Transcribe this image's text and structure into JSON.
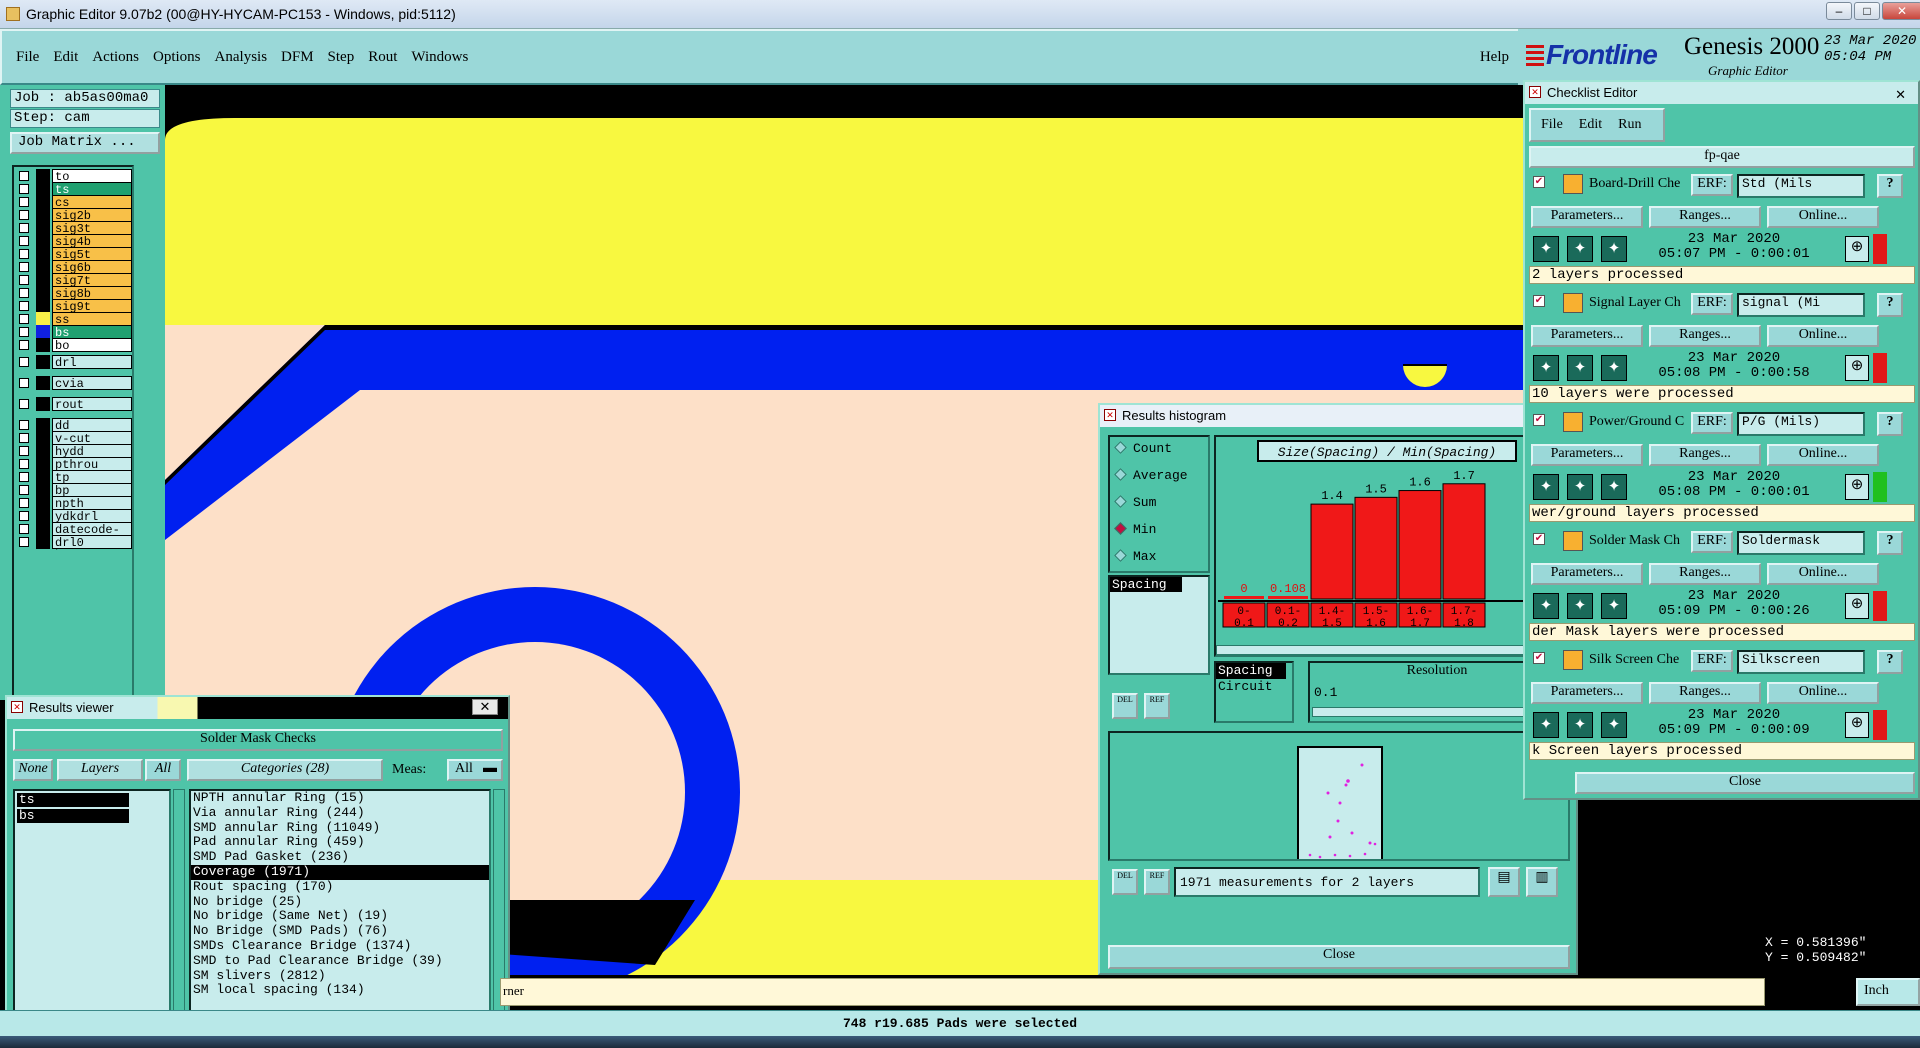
{
  "window": {
    "title": "Graphic Editor 9.07b2 (00@HY-HYCAM-PC153 - Windows, pid:5112)"
  },
  "menu": {
    "items": [
      "File",
      "Edit",
      "Actions",
      "Options",
      "Analysis",
      "DFM",
      "Step",
      "Rout",
      "Windows"
    ],
    "help": "Help"
  },
  "brand": {
    "logo": "Frontline",
    "product": "Genesis 2000",
    "subtitle": "Graphic Editor",
    "date": "23 Mar 2020",
    "time": "05:04 PM"
  },
  "job": {
    "job_label": "Job : ab5as00ma0",
    "step_label": "Step: cam",
    "matrix_button": "Job Matrix ..."
  },
  "layers": [
    {
      "name": "to",
      "kind": "white",
      "swatch": "#000000"
    },
    {
      "name": "ts",
      "kind": "sel",
      "swatch": "#000000"
    },
    {
      "name": "cs",
      "kind": "board",
      "swatch": "#000000"
    },
    {
      "name": "sig2b",
      "kind": "board",
      "swatch": "#000000"
    },
    {
      "name": "sig3t",
      "kind": "board",
      "swatch": "#000000"
    },
    {
      "name": "sig4b",
      "kind": "board",
      "swatch": "#000000"
    },
    {
      "name": "sig5t",
      "kind": "board",
      "swatch": "#000000"
    },
    {
      "name": "sig6b",
      "kind": "board",
      "swatch": "#000000"
    },
    {
      "name": "sig7t",
      "kind": "board",
      "swatch": "#000000"
    },
    {
      "name": "sig8b",
      "kind": "board",
      "swatch": "#000000"
    },
    {
      "name": "sig9t",
      "kind": "board",
      "swatch": "#000000"
    },
    {
      "name": "ss",
      "kind": "board",
      "swatch": "#f8f048"
    },
    {
      "name": "bs",
      "kind": "sel",
      "swatch": "#1020e0"
    },
    {
      "name": "bo",
      "kind": "white",
      "swatch": "#000000"
    },
    {
      "name": "drl",
      "kind": "plain",
      "swatch": "#000000"
    },
    {
      "name": "cvia",
      "kind": "plain",
      "swatch": "#000000"
    },
    {
      "name": "rout",
      "kind": "plain",
      "swatch": "#000000"
    },
    {
      "name": "dd",
      "kind": "plain",
      "swatch": "#000000"
    },
    {
      "name": "v-cut",
      "kind": "plain",
      "swatch": "#000000"
    },
    {
      "name": "hydd",
      "kind": "plain",
      "swatch": "#000000"
    },
    {
      "name": "pthrou",
      "kind": "plain",
      "swatch": "#000000"
    },
    {
      "name": "tp",
      "kind": "plain",
      "swatch": "#000000"
    },
    {
      "name": "bp",
      "kind": "plain",
      "swatch": "#000000"
    },
    {
      "name": "npth",
      "kind": "plain",
      "swatch": "#000000"
    },
    {
      "name": "ydkdrl",
      "kind": "plain",
      "swatch": "#000000"
    },
    {
      "name": "datecode-ptc",
      "kind": "plain",
      "swatch": "#000000"
    },
    {
      "name": "drl0",
      "kind": "plain",
      "swatch": "#000000"
    }
  ],
  "results_viewer": {
    "title": "Results viewer",
    "header": "Solder Mask Checks",
    "none_btn": "None",
    "layers_label": "Layers",
    "all_btn": "All",
    "categories_label": "Categories (28)",
    "meas_label": "Meas:",
    "meas_value": "All",
    "layer_items": [
      "ts",
      "bs"
    ],
    "categories": [
      "NPTH annular Ring (15)",
      "Via annular Ring (244)",
      "SMD annular Ring (11049)",
      "Pad annular Ring (459)",
      "SMD Pad Gasket (236)",
      "Coverage (1971)",
      "Rout spacing (170)",
      "No bridge (25)",
      "No bridge (Same Net) (19)",
      "No Bridge (SMD Pads) (76)",
      "SMDs Clearance Bridge (1374)",
      "SMD to Pad Clearance Bridge (39)",
      "SM slivers (2812)",
      "SM local spacing (134)"
    ],
    "selected_index": 5
  },
  "histogram": {
    "title": "Results histogram",
    "modes": [
      "Count",
      "Average",
      "Sum",
      "Min",
      "Max"
    ],
    "selected_mode": "Min",
    "list_item": "Spacing",
    "chart_title": "Size(Spacing) / Min(Spacing)",
    "chart_data": {
      "type": "bar",
      "categories": [
        "0-0.1",
        "0.1-0.2",
        "1.4-1.5",
        "1.5-1.6",
        "1.6-1.7",
        "1.7-1.8"
      ],
      "values": [
        0,
        0.108,
        1.4,
        1.5,
        1.6,
        1.7
      ],
      "value_labels": [
        "0",
        "0.108",
        "1.4",
        "1.5",
        "1.6",
        "1.7"
      ],
      "ylim": [
        0,
        1.8
      ]
    },
    "sub_list": [
      "Spacing",
      "Circuit"
    ],
    "resolution_label": "Resolution",
    "resolution_value": "0.1",
    "del_label": "DEL",
    "ref_label": "REF",
    "measurements_text": "1971 measurements for 2 layers",
    "close_label": "Close"
  },
  "checklist": {
    "title": "Checklist Editor",
    "menu": [
      "File",
      "Edit",
      "Run"
    ],
    "name": "fp-qae",
    "erf_label": "ERF:",
    "params_label": "Parameters...",
    "ranges_label": "Ranges...",
    "online_label": "Online...",
    "checks": [
      {
        "name": "Board-Drill Che",
        "erf": "Std (Mils",
        "date": "23 Mar 2020",
        "time": "05:07 PM - 0:00:01",
        "status": "2 layers processed",
        "flag": "#e01818"
      },
      {
        "name": "Signal Layer Ch",
        "erf": "signal (Mi",
        "date": "23 Mar 2020",
        "time": "05:08 PM - 0:00:58",
        "status": "10 layers were processed",
        "flag": "#e01818"
      },
      {
        "name": "Power/Ground C",
        "erf": "P/G (Mils)",
        "date": "23 Mar 2020",
        "time": "05:08 PM - 0:00:01",
        "status": "wer/ground layers processed",
        "flag": "#20c020"
      },
      {
        "name": "Solder Mask Ch",
        "erf": "Soldermask",
        "date": "23 Mar 2020",
        "time": "05:09 PM - 0:00:26",
        "status": "der Mask layers were processed",
        "flag": "#e01818"
      },
      {
        "name": "Silk Screen Che",
        "erf": "Silkscreen",
        "date": "23 Mar 2020",
        "time": "05:09 PM - 0:00:09",
        "status": "k Screen layers processed",
        "flag": "#e01818"
      }
    ],
    "close_label": "Close"
  },
  "coords": {
    "x": "X = 0.581396\"",
    "y": "Y = 0.509482\""
  },
  "status": {
    "message": "rner",
    "units": "Inch",
    "selection": "748 r19.685 Pads were selected"
  }
}
